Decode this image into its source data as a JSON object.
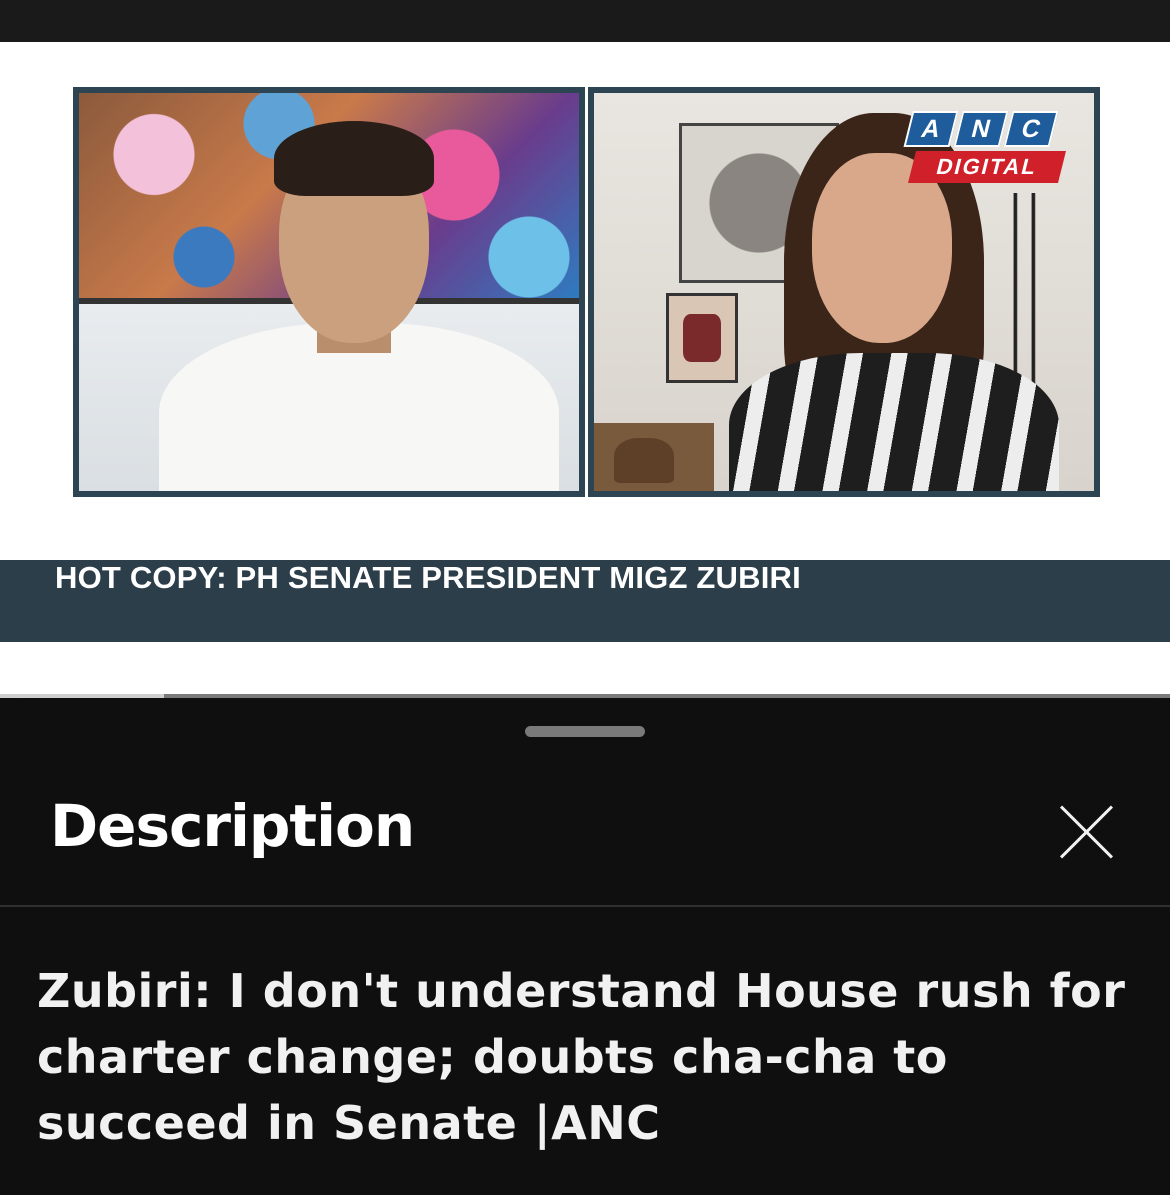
{
  "video": {
    "channel_logo": {
      "top": "ANC",
      "letters": [
        "A",
        "N",
        "C"
      ],
      "bottom": "DIGITAL"
    },
    "lower_third": "HOT COPY: PH SENATE PRESIDENT MIGZ ZUBIRI",
    "progress": 0.14
  },
  "sheet": {
    "title": "Description",
    "close_icon": "close-icon"
  },
  "description": {
    "video_title": "Zubiri: I don't understand House rush for charter change; doubts cha-cha to succeed in Senate |ANC"
  },
  "colors": {
    "lower_third_bg": "#2c3e4a",
    "panel_border": "#2d4552",
    "logo_blue": "#1f5c9c",
    "logo_red": "#d0202a",
    "sheet_bg": "#0f0f0f"
  }
}
